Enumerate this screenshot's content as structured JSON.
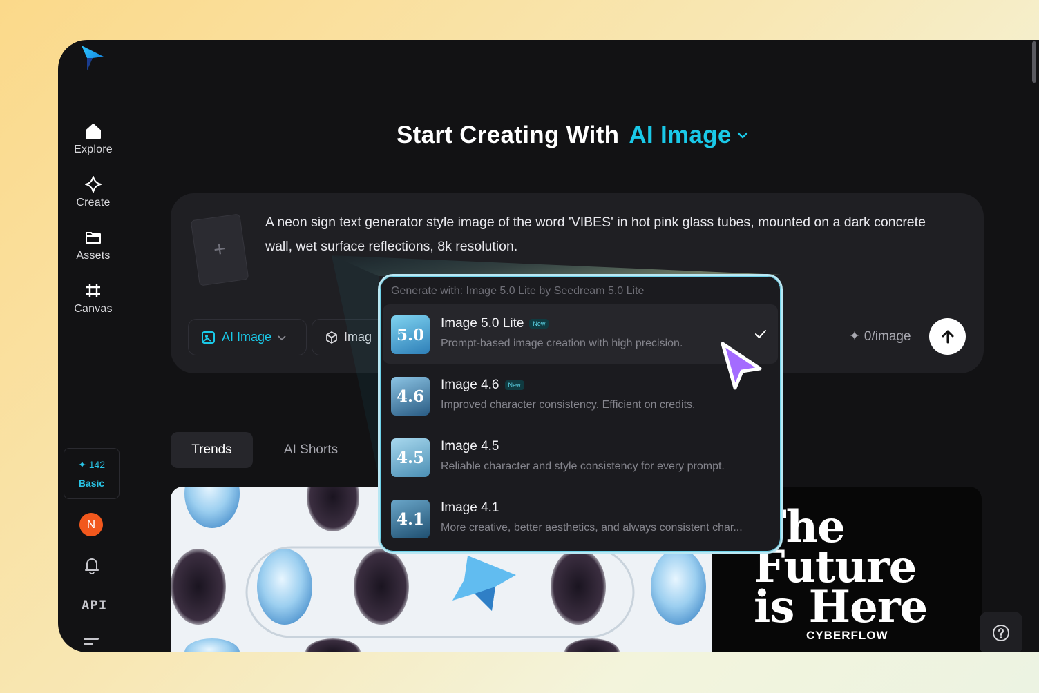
{
  "sidebar": {
    "items": [
      {
        "label": "Explore",
        "icon": "home-icon"
      },
      {
        "label": "Create",
        "icon": "sparkle-diamond-icon"
      },
      {
        "label": "Assets",
        "icon": "folder-icon"
      },
      {
        "label": "Canvas",
        "icon": "frame-icon"
      }
    ],
    "credits": {
      "count": "142",
      "plan": "Basic"
    },
    "avatar_initial": "N",
    "api_label": "API"
  },
  "header": {
    "prefix": "Start Creating With",
    "accent": "AI Image"
  },
  "prompt": {
    "text": "A neon sign text generator style image of the word 'VIBES' in hot pink glass tubes, mounted on a dark concrete wall, wet surface reflections, 8k resolution.",
    "mode_pill": "AI Image",
    "model_pill": "Imag",
    "cost": "0/image"
  },
  "tabs": [
    {
      "label": "Trends",
      "active": true
    },
    {
      "label": "AI Shorts",
      "active": false
    }
  ],
  "banner": {
    "headline_lines": [
      "The",
      "Future",
      "is Here"
    ],
    "brand": "CYBERFLOW"
  },
  "dropdown": {
    "header": "Generate with: Image 5.0 Lite by Seedream 5.0 Lite",
    "items": [
      {
        "thumb": "5.0",
        "title": "Image 5.0 Lite",
        "badge": "New",
        "desc": "Prompt-based image creation with high precision.",
        "selected": true
      },
      {
        "thumb": "4.6",
        "title": "Image 4.6",
        "badge": "New",
        "desc": "Improved character consistency. Efficient on credits.",
        "selected": false
      },
      {
        "thumb": "4.5",
        "title": "Image 4.5",
        "badge": "",
        "desc": "Reliable character and style consistency for every prompt.",
        "selected": false
      },
      {
        "thumb": "4.1",
        "title": "Image 4.1",
        "badge": "",
        "desc": "More creative, better aesthetics, and always consistent char...",
        "selected": false
      }
    ]
  },
  "colors": {
    "accent": "#1ac9e8",
    "avatar": "#f2581d",
    "cursor": "#a46bff"
  }
}
